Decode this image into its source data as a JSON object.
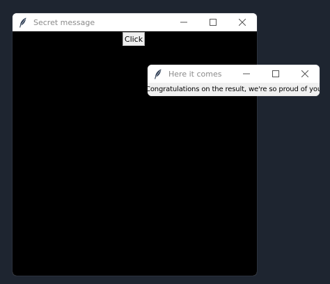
{
  "main_window": {
    "title": "Secret message",
    "icon": "feather-icon",
    "button_label": "Click",
    "background_color": "#000000"
  },
  "popup_window": {
    "title": "Here it comes",
    "icon": "feather-icon",
    "message": "Congratulations on the result, we're so proud of you"
  },
  "colors": {
    "desktop": "#1e2530",
    "titlebar": "#ffffff",
    "title_text": "#8a8a8a"
  }
}
